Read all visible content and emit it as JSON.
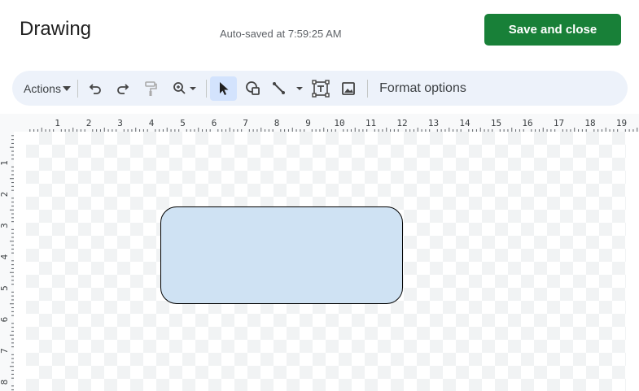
{
  "header": {
    "title": "Drawing",
    "autosave": "Auto-saved at 7:59:25 AM",
    "save_label": "Save and close"
  },
  "toolbar": {
    "actions_label": "Actions",
    "format_options_label": "Format options",
    "buttons": [
      {
        "icon": "undo-icon"
      },
      {
        "icon": "redo-icon"
      },
      {
        "icon": "paint-format-icon"
      },
      {
        "icon": "zoom-icon"
      },
      {
        "icon": "select-icon",
        "active": true
      },
      {
        "icon": "shape-icon"
      },
      {
        "icon": "line-icon"
      },
      {
        "icon": "text-box-icon"
      },
      {
        "icon": "image-icon"
      }
    ]
  },
  "ruler": {
    "horizontal_labels": [
      "1",
      "2",
      "3",
      "4",
      "5",
      "6",
      "7",
      "8",
      "9",
      "10",
      "11",
      "12",
      "13",
      "14",
      "15",
      "16",
      "17",
      "18",
      "19"
    ],
    "vertical_labels": [
      "1",
      "2",
      "3",
      "4",
      "5",
      "6",
      "7",
      "8"
    ]
  },
  "colors": {
    "save_button": "#188038",
    "shape_fill": "#cfe2f3",
    "toolbar_bg": "#edf2fa",
    "active_tool": "#d3e3fd"
  }
}
